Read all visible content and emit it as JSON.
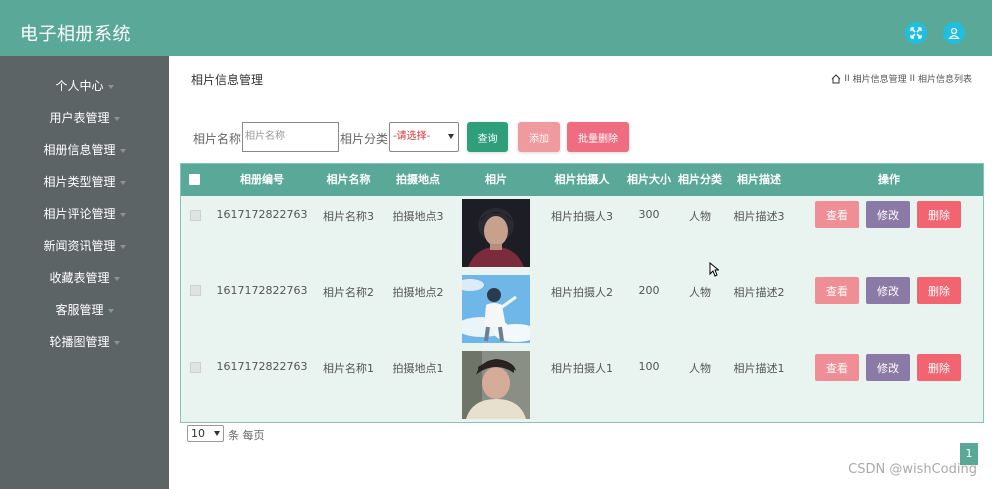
{
  "header": {
    "title": "电子相册系统"
  },
  "sidebar": {
    "items": [
      {
        "label": "个人中心"
      },
      {
        "label": "用户表管理"
      },
      {
        "label": "相册信息管理"
      },
      {
        "label": "相片类型管理"
      },
      {
        "label": "相片评论管理"
      },
      {
        "label": "新闻资讯管理"
      },
      {
        "label": "收藏表管理"
      },
      {
        "label": "客服管理"
      },
      {
        "label": "轮播图管理"
      }
    ]
  },
  "main": {
    "title": "相片信息管理",
    "breadcrumb": {
      "sep": "II",
      "level1": "相片信息管理",
      "level2": "相片信息列表"
    }
  },
  "search": {
    "name_label": "相片名称",
    "name_placeholder": "相片名称",
    "category_label": "相片分类",
    "category_value": "-请选择-",
    "query_button": "查询",
    "add_button": "添加",
    "batch_delete_button": "批量删除"
  },
  "table": {
    "columns": [
      "相册编号",
      "相片名称",
      "拍摄地点",
      "相片",
      "相片拍摄人",
      "相片大小",
      "相片分类",
      "相片描述",
      "操作"
    ],
    "actions": {
      "view": "查看",
      "edit": "修改",
      "delete": "删除"
    },
    "rows": [
      {
        "id": "1617172822763",
        "name": "相片名称3",
        "location": "拍摄地点3",
        "photographer": "相片拍摄人3",
        "size": "300",
        "category": "人物",
        "description": "相片描述3"
      },
      {
        "id": "1617172822763",
        "name": "相片名称2",
        "location": "拍摄地点2",
        "photographer": "相片拍摄人2",
        "size": "200",
        "category": "人物",
        "description": "相片描述2"
      },
      {
        "id": "1617172822763",
        "name": "相片名称1",
        "location": "拍摄地点1",
        "photographer": "相片拍摄人1",
        "size": "100",
        "category": "人物",
        "description": "相片描述1"
      }
    ]
  },
  "pagination": {
    "page_size": "10",
    "per_page_label": "条 每页",
    "current_page": "1"
  },
  "watermark": "CSDN @wishCoding",
  "colors": {
    "header": "#5aa898",
    "sidebar": "#5c6466",
    "query": "#2f9e7a",
    "add": "#ee9a9f",
    "batch_delete": "#f06c80",
    "view": "#ef8f95",
    "edit": "#8b7aa5",
    "delete": "#f2646f"
  }
}
